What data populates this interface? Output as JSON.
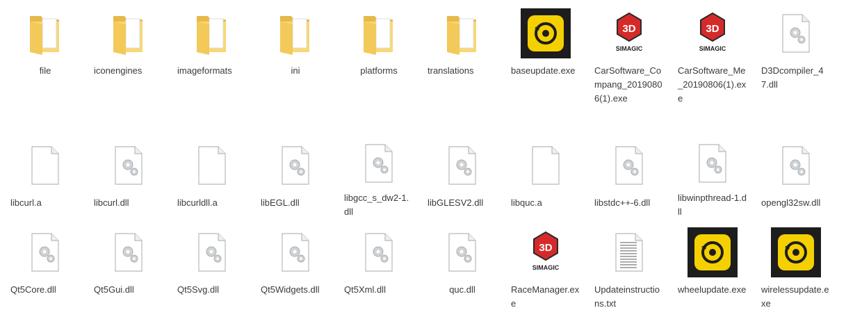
{
  "files": [
    {
      "name": "file",
      "type": "folder"
    },
    {
      "name": "iconengines",
      "type": "folder"
    },
    {
      "name": "imageformats",
      "type": "folder"
    },
    {
      "name": "ini",
      "type": "folder"
    },
    {
      "name": "platforms",
      "type": "folder"
    },
    {
      "name": "translations",
      "type": "folder"
    },
    {
      "name": "baseupdate.exe",
      "type": "app-yellow"
    },
    {
      "name": "CarSoftware_Compang_20190806(1).exe",
      "type": "app-simagic",
      "logo_text": "SIMAGIC"
    },
    {
      "name": "CarSoftware_Me_20190806(1).exe",
      "type": "app-simagic",
      "logo_text": "SIMAGIC"
    },
    {
      "name": "D3Dcompiler_47.dll",
      "type": "dll"
    },
    {
      "name": "libcurl.a",
      "type": "blank"
    },
    {
      "name": "libcurl.dll",
      "type": "dll"
    },
    {
      "name": "libcurldll.a",
      "type": "blank"
    },
    {
      "name": "libEGL.dll",
      "type": "dll"
    },
    {
      "name": "libgcc_s_dw2-1.dll",
      "type": "dll"
    },
    {
      "name": "libGLESV2.dll",
      "type": "dll"
    },
    {
      "name": "libquc.a",
      "type": "blank"
    },
    {
      "name": "libstdc++-6.dll",
      "type": "dll"
    },
    {
      "name": "libwinpthread-1.dll",
      "type": "dll"
    },
    {
      "name": "opengl32sw.dll",
      "type": "dll"
    },
    {
      "name": "Qt5Core.dll",
      "type": "dll"
    },
    {
      "name": "Qt5Gui.dll",
      "type": "dll"
    },
    {
      "name": "Qt5Svg.dll",
      "type": "dll"
    },
    {
      "name": "Qt5Widgets.dll",
      "type": "dll"
    },
    {
      "name": "Qt5Xml.dll",
      "type": "dll"
    },
    {
      "name": "quc.dll",
      "type": "dll"
    },
    {
      "name": "RaceManager.exe",
      "type": "app-simagic",
      "logo_text": "SIMAGIC"
    },
    {
      "name": "Updateinstructions.txt",
      "type": "txt"
    },
    {
      "name": "wheelupdate.exe",
      "type": "app-yellow"
    },
    {
      "name": "wirelessupdate.exe",
      "type": "app-yellow"
    }
  ],
  "colors": {
    "folder_body": "#F8D775",
    "folder_tab": "#E8B949",
    "file_border": "#B9B9B9",
    "yellow_app": "#F5D000",
    "simagic_red": "#D62A2A",
    "label_text": "#3a3a3a"
  }
}
